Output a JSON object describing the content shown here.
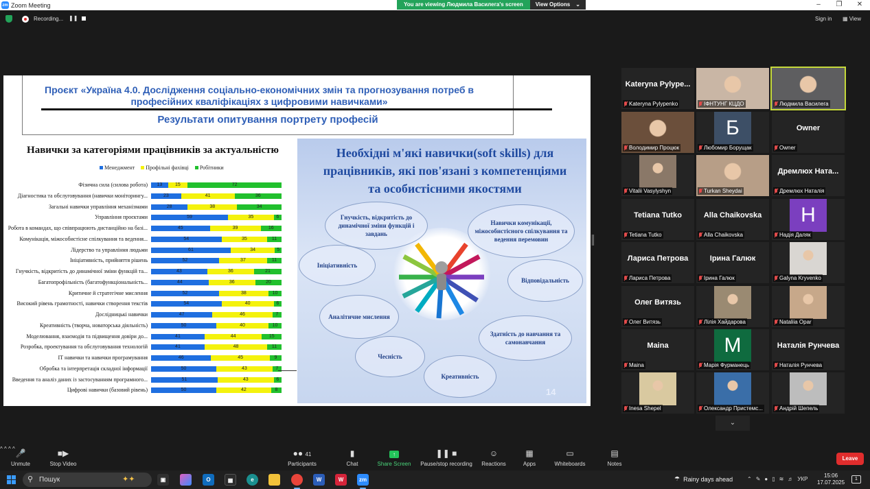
{
  "window": {
    "app_title": "Zoom Meeting",
    "viewing_banner": "You are viewing Людмила Василега's screen",
    "view_options": "View Options",
    "recording_label": "Recording...",
    "sign_in": "Sign in",
    "view": "View"
  },
  "slide": {
    "project_title": "Проєкт «Україна 4.0. Дослідження соціально-економічних змін та прогнозування потреб в професійних кваліфікаціях з цифровими навичками»",
    "results_title": "Результати опитування портрету професій",
    "chart_title": "Навички за категоріями працівників за актуальністю",
    "soft_title": "Необхідні м'які навички(soft skills) для працівників, які пов'язані з компетенціями та особистісними якостями",
    "soft_skills": [
      "Гнучкість, відкритість до динамічної зміни функцій і завдань",
      "Навички комунікації, міжособистісного спілкування та ведення перемовин",
      "Ініціативність",
      "Відповідальність",
      "Аналітичне мислення",
      "Здатність до навчання та самонавчання",
      "Чесність",
      "Креативність"
    ],
    "slide_number": "14"
  },
  "chart_data": {
    "type": "bar",
    "stacked": true,
    "orientation": "horizontal",
    "title": "Навички за категоріями працівників за актуальністю",
    "legend_position": "top",
    "colors": [
      "#1f6fe0",
      "#f4f20d",
      "#21c02d"
    ],
    "series_names": [
      "Менеджмент",
      "Профільні фахівці",
      "Робітники"
    ],
    "categories": [
      "Фізична сила (силова робота)",
      "Діагностика та обслуговування (навички моніторингу...",
      "Загальні навички управління механізмами",
      "Управління проєктами",
      "Робота в командах, що співпрацюють дистанційно на базі...",
      "Комунікація, міжособистісне спілкування та ведення...",
      "Лідерство та управління людьми",
      "Ініціативність, прийняття рішень",
      "Гнучкість, відкритість до динамічної зміни функцій та...",
      "Багатопрофільність (багатофункціональність...",
      "Критичне й стратегічне мислення",
      "Високий рівень грамотності, навички створення текстів",
      "Дослідницькі навички",
      "Креативність (творча, новаторська діяльність)",
      "Моделювання, взаємодія та підвищення довіри до...",
      "Розробка, проектування та обслуговування технологій",
      "ІТ навички та навички програмування",
      "Обробка та інтерпретація складної інформації",
      "Введення та аналіз даних із застосуванням програмного...",
      "Цифрові навички (базовий рівень)"
    ],
    "series": [
      {
        "name": "Менеджмент",
        "values": [
          13,
          23,
          28,
          59,
          45,
          54,
          61,
          52,
          43,
          44,
          52,
          54,
          47,
          50,
          41,
          41,
          46,
          50,
          51,
          50
        ]
      },
      {
        "name": "Профільні фахівці",
        "values": [
          15,
          41,
          38,
          35,
          39,
          35,
          34,
          37,
          36,
          36,
          38,
          40,
          46,
          40,
          44,
          48,
          45,
          43,
          43,
          42
        ]
      },
      {
        "name": "Робітники",
        "values": [
          72,
          36,
          34,
          6,
          16,
          11,
          5,
          11,
          21,
          20,
          10,
          6,
          7,
          10,
          15,
          11,
          9,
          7,
          6,
          8
        ]
      }
    ]
  },
  "participants": [
    {
      "display": "Kateryna  Pylype...",
      "label": "Kateryna Pylypenko",
      "kind": "name"
    },
    {
      "display": "",
      "label": "ІФНТУНГ КЦДО",
      "kind": "photo",
      "bg": "#c9b6a5"
    },
    {
      "display": "",
      "label": "Людмила Василега",
      "kind": "photo",
      "bg": "#5e5e60",
      "active": true
    },
    {
      "display": "",
      "label": "Володимир Процюк",
      "kind": "photo",
      "bg": "#6b4f3b"
    },
    {
      "display": "Б",
      "label": "Любомир Борущак",
      "kind": "letter",
      "bg": "#3d4f66"
    },
    {
      "display": "Owner",
      "label": "Owner",
      "kind": "name"
    },
    {
      "display": "",
      "label": "Vitalii Vasylyshyn",
      "kind": "photo",
      "bg": "#8a7868"
    },
    {
      "display": "",
      "label": "Turkan Sheydai",
      "kind": "photo",
      "bg": "#b79e87"
    },
    {
      "display": "Дремлюх  Ната...",
      "label": "Дремлюх Наталія",
      "kind": "name"
    },
    {
      "display": "Tetiana Tutko",
      "label": "Tetiana Tutko",
      "kind": "name"
    },
    {
      "display": "Alla Chaikovska",
      "label": "Alla Chaikovska",
      "kind": "name"
    },
    {
      "display": "H",
      "label": "Надія Даляк",
      "kind": "letter",
      "bg": "#7b3fbf"
    },
    {
      "display": "Лариса Петрова",
      "label": "Лариса Петрова",
      "kind": "name"
    },
    {
      "display": "Ірина Галюк",
      "label": "Ірина Галюк",
      "kind": "name"
    },
    {
      "display": "",
      "label": "Galyna Kryvenko",
      "kind": "photo",
      "bg": "#d9d6d2"
    },
    {
      "display": "Олег Витязь",
      "label": "Олег Витязь",
      "kind": "name"
    },
    {
      "display": "",
      "label": "Лілія Хайдарова",
      "kind": "photo",
      "bg": "#9a8a72"
    },
    {
      "display": "",
      "label": "Nataliia Opar",
      "kind": "photo",
      "bg": "#c7a88a"
    },
    {
      "display": "Maina",
      "label": "Maina",
      "kind": "name"
    },
    {
      "display": "M",
      "label": "Марія Фурманець",
      "kind": "letter",
      "bg": "#0f6b3f"
    },
    {
      "display": "Наталія Рунчева",
      "label": "Наталія Рунчева",
      "kind": "name"
    },
    {
      "display": "",
      "label": "Inesa Shepel",
      "kind": "photo",
      "bg": "#d9c9a0"
    },
    {
      "display": "",
      "label": "Олександр Пристемс...",
      "kind": "photo",
      "bg": "#3a6ea8"
    },
    {
      "display": "",
      "label": "Андрій Шепель",
      "kind": "photo",
      "bg": "#bdbdbd"
    }
  ],
  "toolbar": {
    "unmute": "Unmute",
    "stop_video": "Stop Video",
    "participants": "Participants",
    "participants_count": "41",
    "chat": "Chat",
    "share_screen": "Share Screen",
    "pause_stop_recording": "Pause/stop recording",
    "reactions": "Reactions",
    "apps": "Apps",
    "whiteboards": "Whiteboards",
    "notes": "Notes",
    "leave": "Leave"
  },
  "taskbar": {
    "search_placeholder": "Пошук",
    "weather": "Rainy days ahead",
    "language": "УКР",
    "time": "15:06",
    "date": "17.07.2025",
    "notif_count": "1"
  }
}
